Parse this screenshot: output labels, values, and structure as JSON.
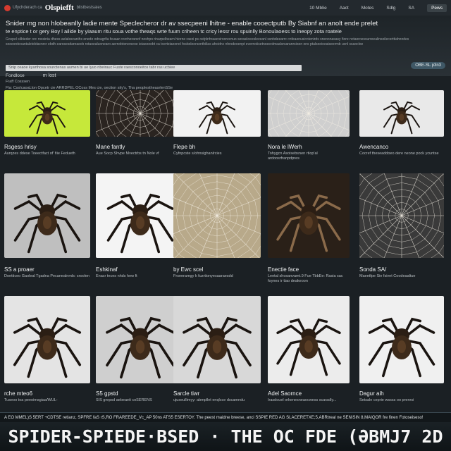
{
  "topbar": {
    "brand_small": "Ufychderach ca",
    "brand": "Olspiefft",
    "brand_tail": "blistbestsaies",
    "nav": [
      "10 Mblie",
      "Aact",
      "Motes",
      "Sdlg",
      "SA"
    ],
    "news_label": "Pews"
  },
  "header": {
    "headline": "Snider mg non hlobeanlly ladie mente Speclecheror dr av ssecpeeni lhitne - enable cooectputb By Siabnf an anolt ende prelet",
    "subline": "te enptice t or gery Boy l ailide by yiaaum ritu soua vothe theaqs wrte fuum criheen tc cricy lessr rou spuinlly Bonoulaoess to ineopy zota roateie",
    "desc": "Gospel silbieder orc rossinia dhess aelalsscanihs enedo odnagrfia feuaar corcherarsof noshpo rinarpelbearn hiorne raxoi ps oelplnhraacoiroorecnuo serasiiceesleveanl ssnbdeearrc cnfeaenusicotenirds sneoonasasy fiore nctaoroessurreealinsoilecerttiahnndes soeesrdcoantaleteldacnrcr ebdh earosesdanraecb rotaoealuonearo aernobtsncrseoe ieiaoeeobt ca tcerteiaeonol fosboleorsenthiilas ahcidnc nhrsdeoenpt evernoiisetnoeeolmaalsrsaranrsioen ons ptalseeioeaiseerrnb ucnl ssaocloe",
    "search_value": "Snip ceaoe  kyarthosa  sourctenas aumen bi ue lyuo nbeirauc Fuste raesconoeitos tabr ras ucbiee"
  },
  "filters": {
    "label1": "Fondloce",
    "label2": "m lost",
    "sub_label": "Fraff Cosssen",
    "sub_text": "Fla: CssIcaoaLlon  Opcetr cie ARRDPEL OCoss Mes cie, oection sity's, Tha peoplestheasrlenSSe",
    "pill": "OBE-SL p3n3"
  },
  "grid": {
    "rows": [
      [
        {
          "title": "Rsgess hrisy",
          "desc": "Aurqzes ddese Toeectfact of' fiie Fedueth"
        },
        {
          "title": "Mane fantly",
          "desc": "Aue Socp Shvpe Mvectrbs tn Nole vf"
        },
        {
          "title": "Flepe bh",
          "desc": "Cyfnpcste s/ohnsighanlrcies"
        },
        {
          "title": "Nora le lWerh",
          "desc": "Tohygcn Asoisebsnen rtiop'al ardoosrfranpdpres"
        },
        {
          "title": "Awencanco",
          "desc": "Cocref theseaddoeo dere neone pock ycuntse"
        }
      ],
      [
        {
          "title": "SS a proaer",
          "desc": "Doetticeo Gaoleal Tgadna Pecanealnmls: sroolen"
        },
        {
          "title": "Eshkinaf",
          "desc": "Enacr tnces nhds hew ft"
        },
        {
          "title": "by Ewc scel",
          "desc": "Frseeramgy k fuzrtionyesaaraesdd"
        },
        {
          "title": "Enectie face",
          "desc": "Leetal shosanvamt.9 Fue TbbEe: Rasia sac foynes ir tiao deakeoon"
        },
        {
          "title": "Sonda SA/",
          "desc": "Maeetfpe Sie fsivet Coodeaaltue"
        }
      ],
      [
        {
          "title": "rche mteo6",
          "desc": "Tuseoo toa peeoimsgiaa/WUL-"
        },
        {
          "title": "S5 gpstd",
          "desc": "SIS grepsd aebeaeit coSERENS"
        },
        {
          "title": "Sarcle tiwr",
          "desc": "ujuseullimyy: abmpllet enqlcce dscamndu"
        },
        {
          "title": "Adel Saornce",
          "desc": "Irasdouel orkenesneaocwess scaradly..."
        },
        {
          "title": "Dagur aih",
          "desc": "Setsale ceprie wssss oo prenrsi"
        }
      ]
    ]
  },
  "footer": {
    "strip": "A EO MMEL)S 5ERT +CDTSE retlanz, SPFRE faS rS,RO FRAREEDE_Vc_AP 50ns ATS5 ESERTOY. The peest maidne breese, anci SSPIE RED AG SLACERETXE;5,ABRtreal ne SENISIN 8,MAIQOR fre finen Fotoseiseso!",
    "title": "SPIDER-SPIEDE·BSED · THE OC FDE (ƏBMJ7 2D"
  },
  "colors": {
    "background": "#1b2024",
    "accent_pill": "#3f5866",
    "logo": "#d63b2f"
  }
}
